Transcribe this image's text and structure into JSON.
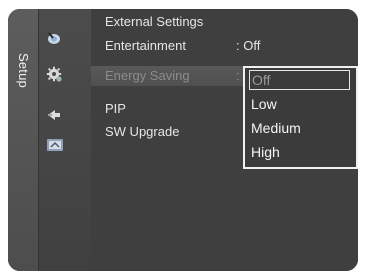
{
  "menu": {
    "section_title": "Setup",
    "items": [
      {
        "label": "External Settings",
        "value": ""
      },
      {
        "label": "Entertainment",
        "value": ": Off"
      },
      {
        "label": "Energy Saving",
        "value": ":"
      },
      {
        "label": "PIP",
        "value": ""
      },
      {
        "label": "SW Upgrade",
        "value": ""
      }
    ]
  },
  "dropdown": {
    "options": [
      "Off",
      "Low",
      "Medium",
      "High"
    ],
    "selected": "Off"
  },
  "icons": [
    "satellite-dish-icon",
    "gear-icon",
    "pip-icon",
    "sw-upgrade-icon"
  ]
}
